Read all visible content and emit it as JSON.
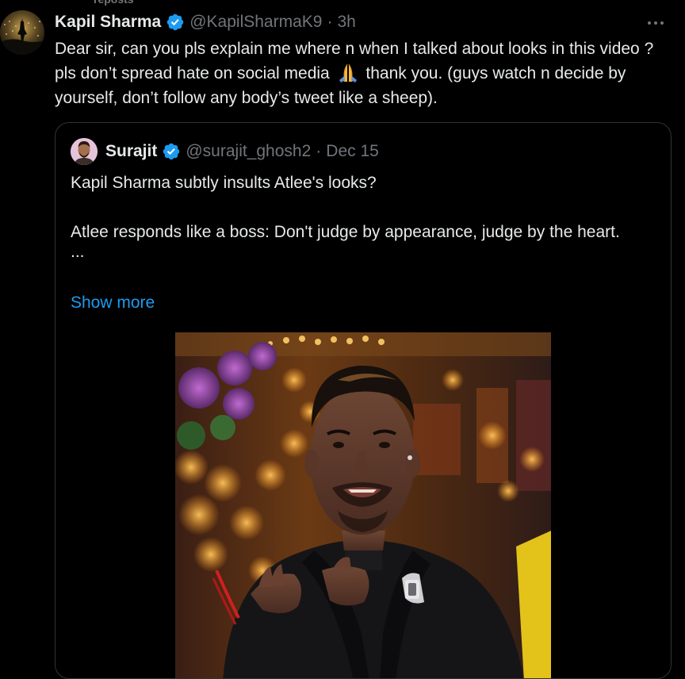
{
  "repost_context": "reposts",
  "tweet": {
    "author_name": "Kapil Sharma",
    "handle": "@KapilSharmaK9",
    "dot": "·",
    "time": "3h",
    "text_part1": "Dear sir, can you pls explain me where n when I talked about looks in this video ? pls don’t spread hate on social media",
    "text_part2": "thank you. (guys watch n decide by yourself, don’t follow any body’s tweet like a sheep).",
    "emoji": "pray-emoji"
  },
  "quoted_tweet": {
    "author_name": "Surajit",
    "handle": "@surajit_ghosh2",
    "dot": "·",
    "date": "Dec 15",
    "line1": "Kapil Sharma subtly insults Atlee's looks?",
    "line2": "Atlee responds like a boss: Don't judge by appearance, judge by the heart.",
    "ellipsis": "...",
    "show_more": "Show more"
  },
  "icons": {
    "verified": "verified-badge-icon",
    "more": "more-options-icon"
  },
  "colors": {
    "background": "#000000",
    "text": "#e7e9ea",
    "secondary": "#71767b",
    "accent": "#1d9bf0",
    "border": "#2f3336"
  }
}
